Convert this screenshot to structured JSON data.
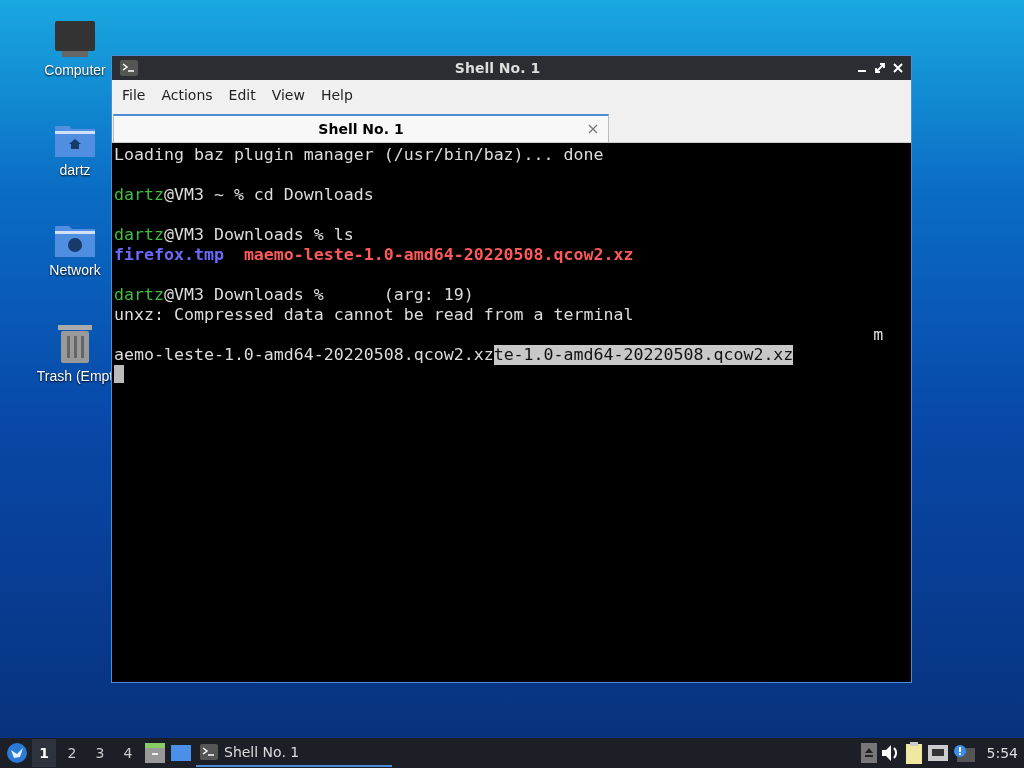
{
  "desktop_icons": [
    {
      "label": "Computer",
      "kind": "computer"
    },
    {
      "label": "dartz",
      "kind": "home"
    },
    {
      "label": "Network",
      "kind": "network"
    },
    {
      "label": "Trash (Empt",
      "kind": "trash"
    }
  ],
  "window": {
    "title": "Shell No. 1",
    "menu": [
      "File",
      "Actions",
      "Edit",
      "View",
      "Help"
    ],
    "tabs": [
      {
        "label": "Shell No. 1",
        "selected": true
      }
    ],
    "terminal": {
      "lines": [
        {
          "kind": "text",
          "segments": [
            {
              "kind": "plain",
              "text": "Loading baz plugin manager (/usr/bin/baz)... done"
            }
          ]
        },
        {
          "kind": "blank"
        },
        {
          "kind": "text",
          "segments": [
            {
              "kind": "user",
              "text": "dartz"
            },
            {
              "kind": "plain",
              "text": "@VM3 ~ % cd Downloads"
            }
          ]
        },
        {
          "kind": "blank"
        },
        {
          "kind": "text",
          "segments": [
            {
              "kind": "user",
              "text": "dartz"
            },
            {
              "kind": "plain",
              "text": "@VM3 Downloads % ls"
            }
          ]
        },
        {
          "kind": "text",
          "segments": [
            {
              "kind": "file",
              "text": "firefox.tmp"
            },
            {
              "kind": "archive",
              "text": "maemo-leste-1.0-amd64-20220508.qcow2.xz"
            }
          ]
        },
        {
          "kind": "blank"
        },
        {
          "kind": "text",
          "segments": [
            {
              "kind": "user",
              "text": "dartz"
            },
            {
              "kind": "plain",
              "text": "@VM3 Downloads %"
            },
            {
              "kind": "plain",
              "text": "(arg: 19)"
            }
          ]
        },
        {
          "kind": "text",
          "segments": [
            {
              "kind": "plain",
              "text": "unxz: Compressed data cannot be read from a terminal"
            }
          ]
        },
        {
          "kind": "far",
          "segments": [
            {
              "kind": "plain",
              "text": "m"
            }
          ]
        },
        {
          "kind": "text",
          "segments": [
            {
              "kind": "plain",
              "text": "aemo-leste-1.0-amd64-20220508.qcow2.xz"
            },
            {
              "kind": "selected",
              "text": "te-1.0-amd64-20220508.qcow2.xz"
            }
          ]
        },
        {
          "kind": "cursor"
        }
      ]
    }
  },
  "taskbar": {
    "workspaces": [
      {
        "label": "1",
        "selected": true
      },
      {
        "label": "2",
        "selected": false
      },
      {
        "label": "3",
        "selected": false
      },
      {
        "label": "4",
        "selected": false
      }
    ],
    "tasks": [
      {
        "label": "Shell No. 1",
        "selected": true
      }
    ],
    "clock": "5:54"
  }
}
